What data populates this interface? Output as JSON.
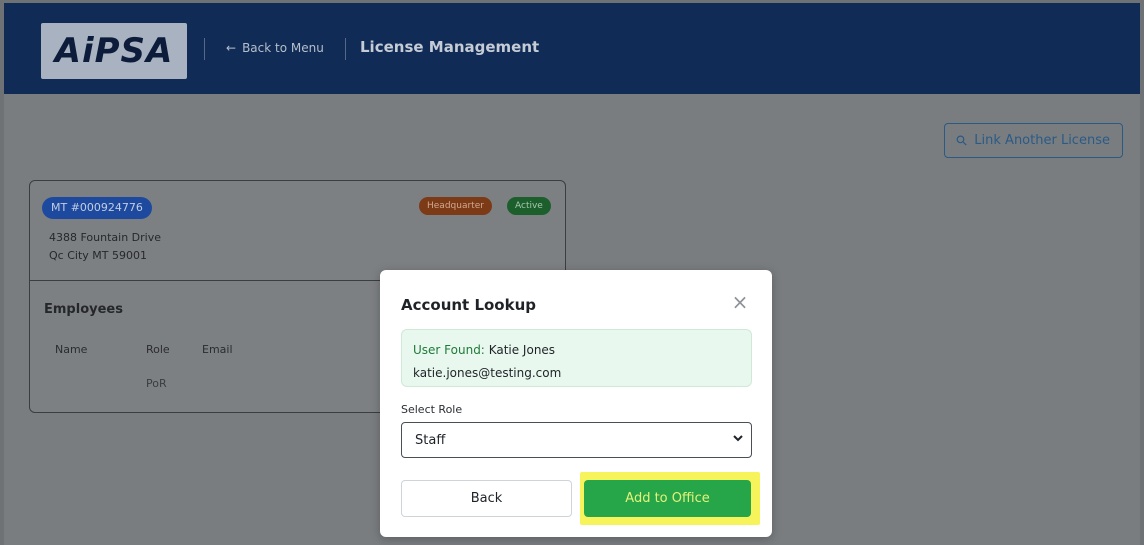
{
  "header": {
    "logo_text": "AiPSA",
    "back_label": "Back to Menu",
    "back_arrow": "←",
    "title": "License Management"
  },
  "actions": {
    "link_license_label": "Link Another License",
    "link_icon": "link-icon"
  },
  "license_card": {
    "license_number": "MT #000924776",
    "badges": {
      "headquarter": "Headquarter",
      "status": "Active"
    },
    "address_line1": "4388 Fountain Drive",
    "address_line2": "Qc City MT 59001",
    "employees_title": "Employees",
    "columns": [
      "Name",
      "Role",
      "Email"
    ],
    "rows": [
      {
        "name": "",
        "role": "PoR",
        "email": ""
      }
    ]
  },
  "modal": {
    "title": "Account Lookup",
    "close_symbol": "×",
    "found_label": "User Found:",
    "found_name": "Katie Jones",
    "found_email": "katie.jones@testing.com",
    "role_label": "Select Role",
    "role_value": "Staff",
    "back_label": "Back",
    "add_label": "Add to Office"
  },
  "colors": {
    "header_bg": "#102b55",
    "add_button": "#27a649",
    "highlight": "#f7f35a",
    "found_bg": "#e9f8ef"
  }
}
